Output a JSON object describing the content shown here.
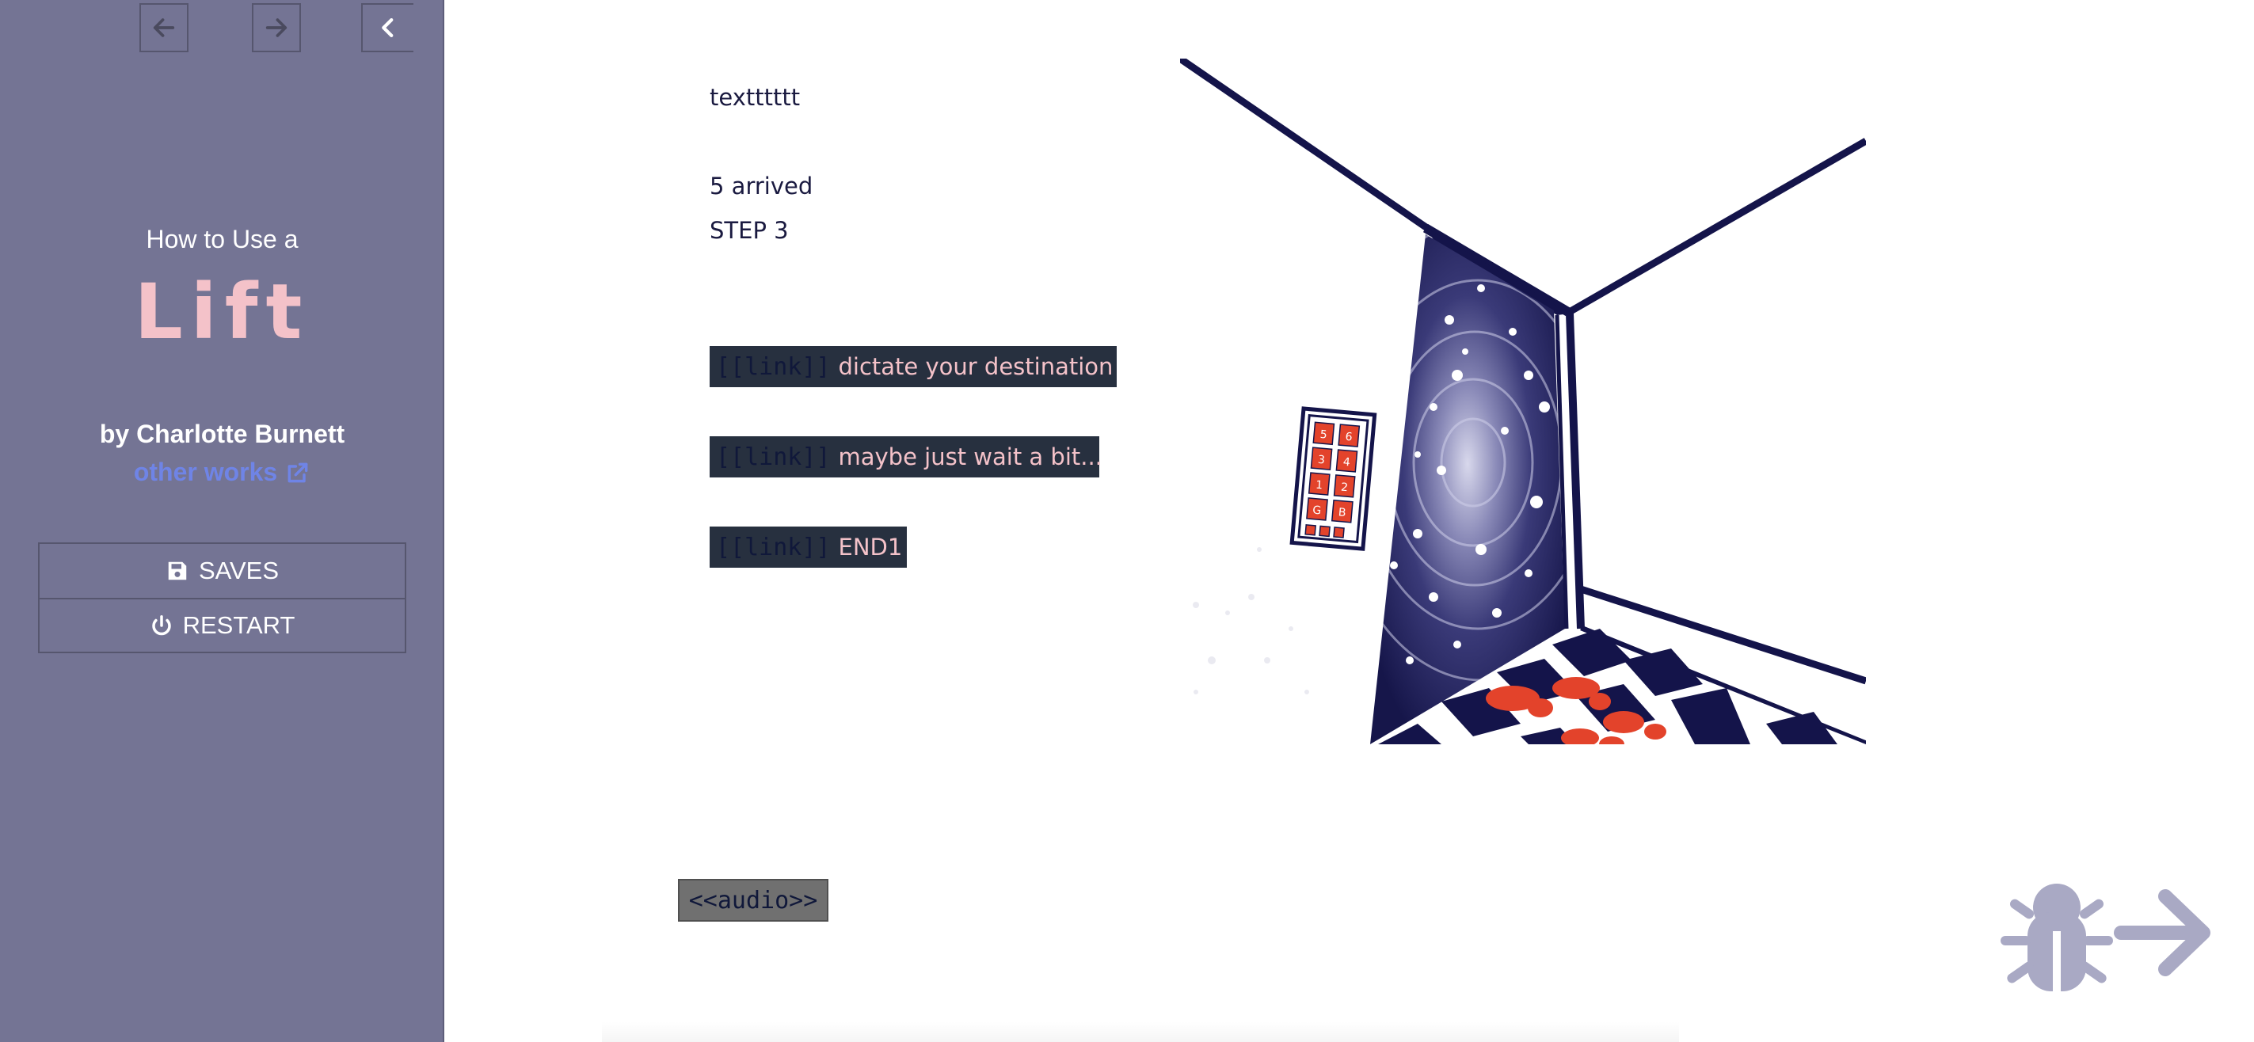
{
  "sidebar": {
    "story_subtitle": "How to Use a",
    "story_title": "Lift",
    "author": "by Charlotte Burnett",
    "other_works": "other works",
    "menu": {
      "saves": "SAVES",
      "restart": "RESTART"
    },
    "icons": [
      "arrow-left-icon",
      "arrow-right-icon",
      "chevron-left-icon",
      "external-link-icon",
      "floppy-disk-icon",
      "power-icon"
    ]
  },
  "passage": {
    "line1": "textttttt",
    "line2": "5 arrived",
    "line3": "STEP 3",
    "links": [
      {
        "macro": "[[link]]",
        "label": "dictate your destination"
      },
      {
        "macro": "[[link]]",
        "label": "maybe just wait a bit..."
      },
      {
        "macro": "[[link]]",
        "label": "END1"
      }
    ],
    "audio_macro": "<<audio>>"
  },
  "lift_panel": {
    "buttons": [
      "5",
      "6",
      "3",
      "4",
      "1",
      "2",
      "G",
      "B"
    ]
  },
  "colors": {
    "sidebar_bg": "#747494",
    "title_pink": "#f4c2c9",
    "link_blue": "#6f84e6",
    "navy": "#14144a",
    "panel_red": "#e3432b"
  },
  "debug": {
    "icons": [
      "bug-icon",
      "arrow-right-icon"
    ]
  }
}
